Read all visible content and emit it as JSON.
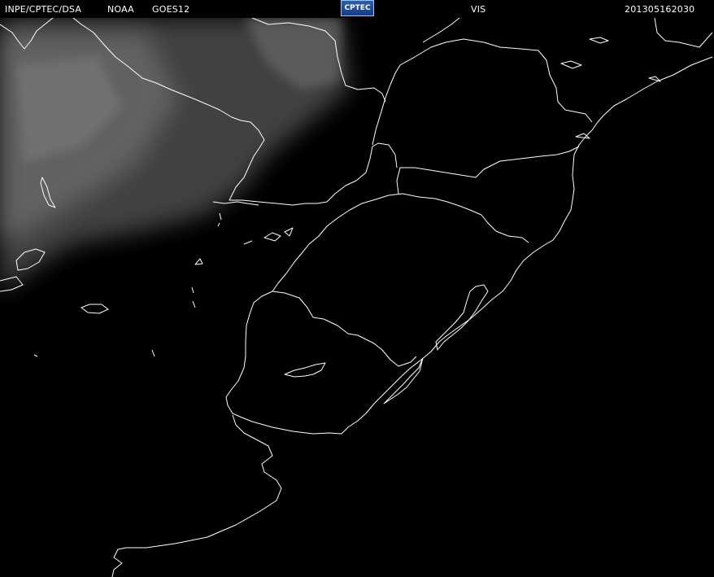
{
  "header": {
    "agency": "INPE/CPTEC/DSA",
    "provider": "NOAA",
    "satellite": "GOES12",
    "logo_text": "CPTEC",
    "channel": "VIS",
    "timestamp": "201305162030"
  },
  "colors": {
    "background": "#000000",
    "outline": "#ffffff",
    "cloud": "#5a5a5a"
  }
}
